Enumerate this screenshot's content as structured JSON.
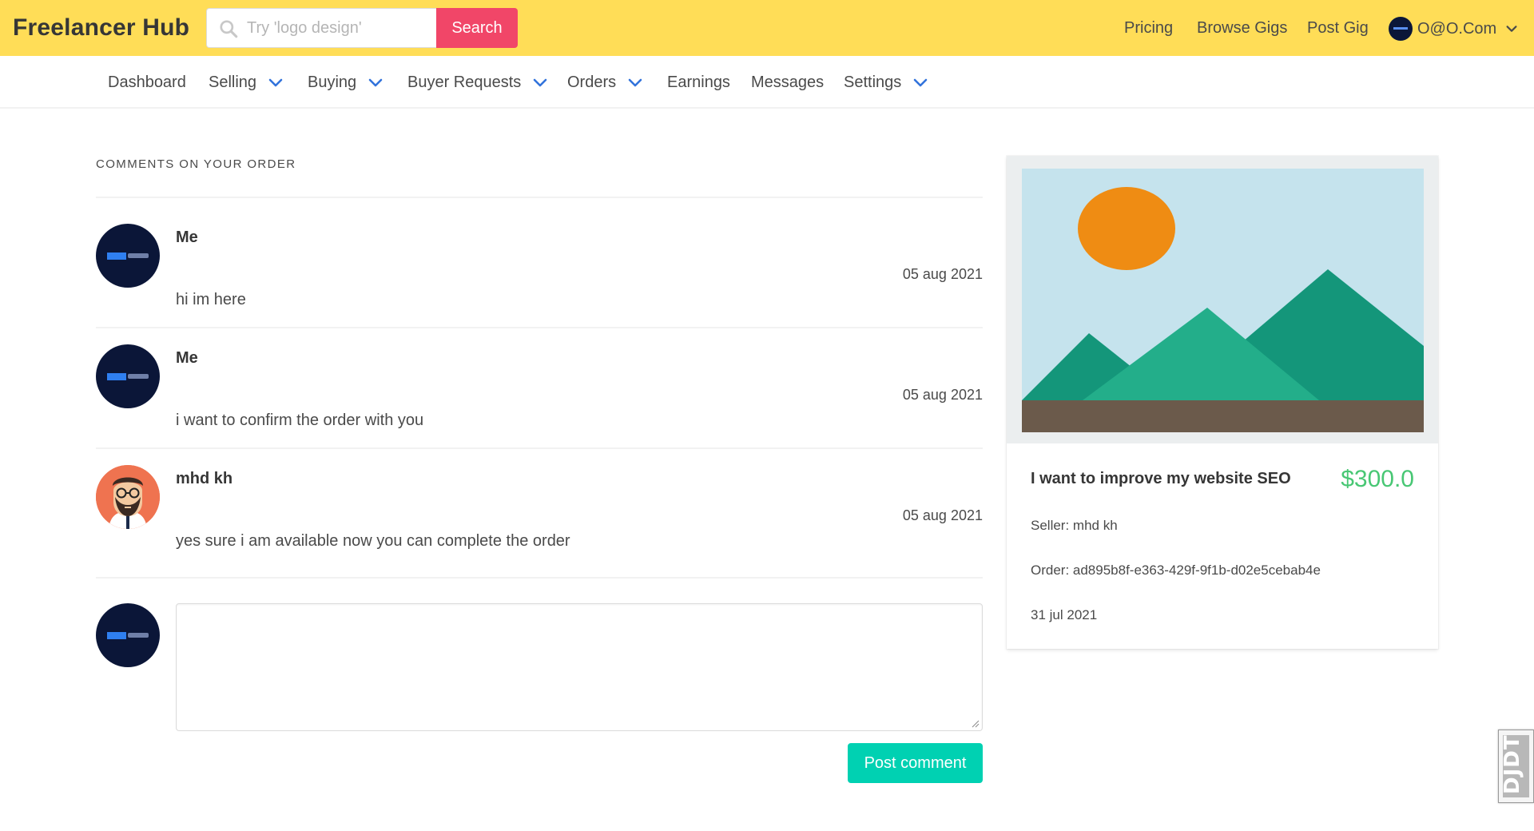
{
  "header": {
    "brand": "Freelancer Hub",
    "search": {
      "placeholder": "Try 'logo design'",
      "value": "",
      "button_label": "Search"
    },
    "links": [
      "Pricing",
      "Browse Gigs",
      "Post Gig"
    ],
    "account_label": "O@O.Com"
  },
  "nav": {
    "items": [
      {
        "label": "Dashboard",
        "has_dropdown": false
      },
      {
        "label": "Selling",
        "has_dropdown": true
      },
      {
        "label": "Buying",
        "has_dropdown": true
      },
      {
        "label": "Buyer Requests",
        "has_dropdown": true
      },
      {
        "label": "Orders",
        "has_dropdown": true
      },
      {
        "label": "Earnings",
        "has_dropdown": false
      },
      {
        "label": "Messages",
        "has_dropdown": false
      },
      {
        "label": "Settings",
        "has_dropdown": true
      }
    ]
  },
  "comments": {
    "section_title": "COMMENTS ON YOUR ORDER",
    "items": [
      {
        "author": "Me",
        "date": "05 aug 2021",
        "text": "hi im here",
        "avatar": "company-logo"
      },
      {
        "author": "Me",
        "date": "05 aug 2021",
        "text": "i want to confirm the order with you",
        "avatar": "company-logo"
      },
      {
        "author": "mhd kh",
        "date": "05 aug 2021",
        "text": "yes sure i am available now you can complete the order",
        "avatar": "bearded-man-illustration"
      }
    ],
    "reply": {
      "value": "",
      "button_label": "Post comment"
    }
  },
  "gig_card": {
    "image": "landscape-placeholder",
    "title": "I want to improve my website SEO",
    "price": "$300.0",
    "seller": "Seller: mhd kh",
    "order": "Order: ad895b8f-e363-429f-9f1b-d02e5cebab4e",
    "date": "31 jul 2021"
  },
  "side_widget": {
    "label": "DJDT"
  },
  "colors": {
    "topbar": "#ffdd57",
    "search_button": "#f14668",
    "post_button": "#00d1b2",
    "price": "#48c774",
    "nav_chevron": "#3273dc",
    "avatar_dark": "#0b1638",
    "avatar_person_bg": "#ef7350"
  }
}
